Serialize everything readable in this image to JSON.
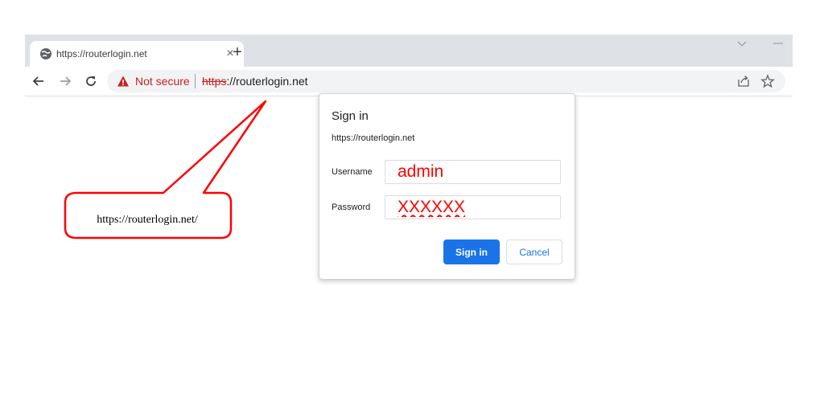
{
  "browser": {
    "tab": {
      "title": "https://routerlogin.net",
      "close_glyph": "×",
      "favicon": "globe-icon"
    },
    "new_tab_glyph": "+",
    "toolbar": {
      "security_label": "Not secure",
      "url_scheme": "https",
      "url_rest": "://routerlogin.net"
    }
  },
  "dialog": {
    "title": "Sign in",
    "origin": "https://routerlogin.net",
    "username_label": "Username",
    "username_value": "admin",
    "password_label": "Password",
    "password_value": "XXXXXX",
    "sign_in_label": "Sign in",
    "cancel_label": "Cancel"
  },
  "callout": {
    "text": "https://routerlogin.net/"
  },
  "colors": {
    "accent": "#1a73e8",
    "warning": "#c5221f",
    "annotation": "#ff0000"
  }
}
